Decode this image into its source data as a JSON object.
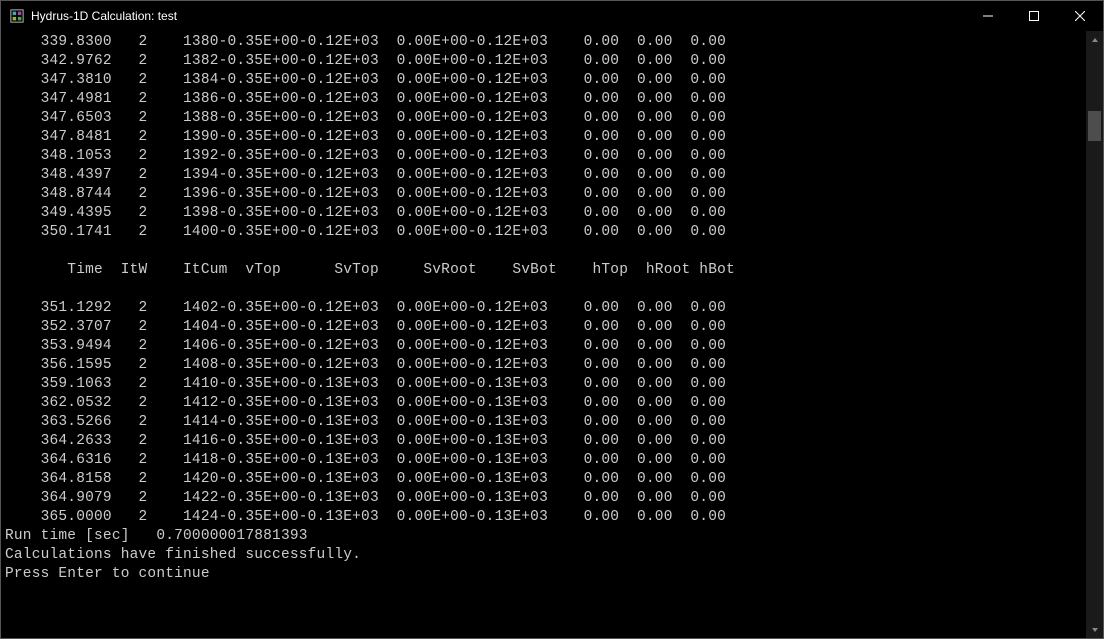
{
  "window": {
    "title": "Hydrus-1D Calculation: test"
  },
  "table1_rows": [
    "    339.8300   2    1380-0.35E+00-0.12E+03  0.00E+00-0.12E+03    0.00  0.00  0.00",
    "    342.9762   2    1382-0.35E+00-0.12E+03  0.00E+00-0.12E+03    0.00  0.00  0.00",
    "    347.3810   2    1384-0.35E+00-0.12E+03  0.00E+00-0.12E+03    0.00  0.00  0.00",
    "    347.4981   2    1386-0.35E+00-0.12E+03  0.00E+00-0.12E+03    0.00  0.00  0.00",
    "    347.6503   2    1388-0.35E+00-0.12E+03  0.00E+00-0.12E+03    0.00  0.00  0.00",
    "    347.8481   2    1390-0.35E+00-0.12E+03  0.00E+00-0.12E+03    0.00  0.00  0.00",
    "    348.1053   2    1392-0.35E+00-0.12E+03  0.00E+00-0.12E+03    0.00  0.00  0.00",
    "    348.4397   2    1394-0.35E+00-0.12E+03  0.00E+00-0.12E+03    0.00  0.00  0.00",
    "    348.8744   2    1396-0.35E+00-0.12E+03  0.00E+00-0.12E+03    0.00  0.00  0.00",
    "    349.4395   2    1398-0.35E+00-0.12E+03  0.00E+00-0.12E+03    0.00  0.00  0.00",
    "    350.1741   2    1400-0.35E+00-0.12E+03  0.00E+00-0.12E+03    0.00  0.00  0.00"
  ],
  "header_row": "       Time  ItW    ItCum  vTop      SvTop     SvRoot    SvBot    hTop  hRoot hBot",
  "table2_rows": [
    "    351.1292   2    1402-0.35E+00-0.12E+03  0.00E+00-0.12E+03    0.00  0.00  0.00",
    "    352.3707   2    1404-0.35E+00-0.12E+03  0.00E+00-0.12E+03    0.00  0.00  0.00",
    "    353.9494   2    1406-0.35E+00-0.12E+03  0.00E+00-0.12E+03    0.00  0.00  0.00",
    "    356.1595   2    1408-0.35E+00-0.12E+03  0.00E+00-0.12E+03    0.00  0.00  0.00",
    "    359.1063   2    1410-0.35E+00-0.13E+03  0.00E+00-0.13E+03    0.00  0.00  0.00",
    "    362.0532   2    1412-0.35E+00-0.13E+03  0.00E+00-0.13E+03    0.00  0.00  0.00",
    "    363.5266   2    1414-0.35E+00-0.13E+03  0.00E+00-0.13E+03    0.00  0.00  0.00",
    "    364.2633   2    1416-0.35E+00-0.13E+03  0.00E+00-0.13E+03    0.00  0.00  0.00",
    "    364.6316   2    1418-0.35E+00-0.13E+03  0.00E+00-0.13E+03    0.00  0.00  0.00",
    "    364.8158   2    1420-0.35E+00-0.13E+03  0.00E+00-0.13E+03    0.00  0.00  0.00",
    "    364.9079   2    1422-0.35E+00-0.13E+03  0.00E+00-0.13E+03    0.00  0.00  0.00",
    "    365.0000   2    1424-0.35E+00-0.13E+03  0.00E+00-0.13E+03    0.00  0.00  0.00"
  ],
  "footer": {
    "runtime": "Run time [sec]   0.700000017881393",
    "status": "Calculations have finished successfully.",
    "prompt": "Press Enter to continue"
  }
}
